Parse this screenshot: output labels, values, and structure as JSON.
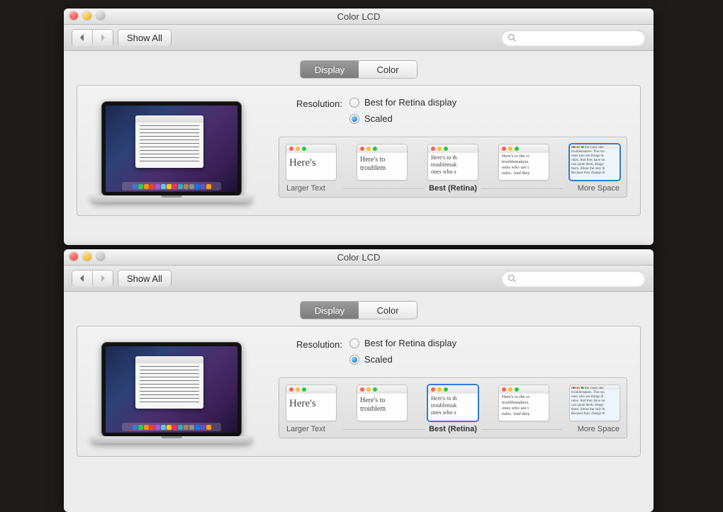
{
  "windowA": {
    "title": "Color LCD",
    "showAll": "Show All",
    "searchPlaceholder": "",
    "tabs": {
      "display": "Display",
      "color": "Color"
    },
    "resolutionLabel": "Resolution:",
    "radioBest": "Best for Retina display",
    "radioScaled": "Scaled",
    "scale": {
      "labels": {
        "left": "Larger Text",
        "mid": "Best (Retina)",
        "right": "More Space"
      },
      "selectedIndex": 4,
      "options": [
        {
          "text": "Here's"
        },
        {
          "text": "Here's to\ntroublem"
        },
        {
          "text": "Here's to th\ntroublemak\nones who s"
        },
        {
          "text": "Here's to the cr\ntroublemakers.\nones who see t\nrules. And they"
        },
        {
          "text": "Here's to the crazy one\ntroublemakers. The rou\nones who see things di\nrules. And they have no\ncan quote them, disagr\nthem. About the only th\nBecause they change th"
        }
      ]
    }
  },
  "windowB": {
    "title": "Color LCD",
    "showAll": "Show All",
    "searchPlaceholder": "",
    "tabs": {
      "display": "Display",
      "color": "Color"
    },
    "resolutionLabel": "Resolution:",
    "radioBest": "Best for Retina display",
    "radioScaled": "Scaled",
    "scale": {
      "labels": {
        "left": "Larger Text",
        "mid": "Best (Retina)",
        "right": "More Space"
      },
      "selectedIndex": 2,
      "options": [
        {
          "text": "Here's"
        },
        {
          "text": "Here's to\ntroublem"
        },
        {
          "text": "Here's to th\ntroublemak\nones who s"
        },
        {
          "text": "Here's to the cr\ntroublemakers.\nones who see t\nrules. And they"
        },
        {
          "text": "Here's to the crazy one\ntroublemakers. The rou\nones who see things di\nrules. And they have no\ncan quote them, disagr\nthem. About the only th\nBecause they change th"
        }
      ]
    }
  },
  "dockColors": [
    "#3a7bd5",
    "#34c759",
    "#ff9500",
    "#ff3b30",
    "#af52de",
    "#5ac8fa",
    "#ffcc00",
    "#ff2d55",
    "#30b0c7",
    "#a2845e",
    "#8e8e93",
    "#007aff",
    "#5856d6",
    "#ff9f0a"
  ]
}
